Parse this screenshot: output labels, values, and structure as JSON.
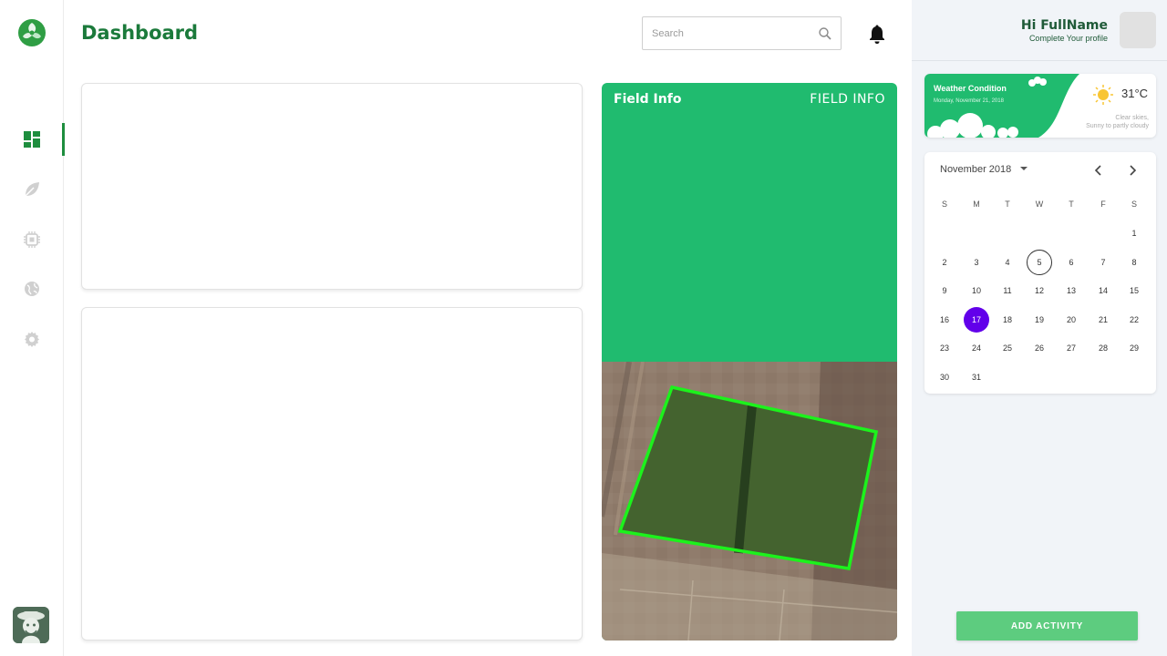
{
  "header": {
    "title": "Dashboard",
    "search_placeholder": "Search"
  },
  "nav": {
    "items": [
      {
        "icon": "dashboard-icon",
        "active": true
      },
      {
        "icon": "leaf-icon",
        "active": false
      },
      {
        "icon": "chip-icon",
        "active": false
      },
      {
        "icon": "globe-icon",
        "active": false
      },
      {
        "icon": "gear-icon",
        "active": false
      }
    ],
    "accent": "#1e8e3e"
  },
  "field_card": {
    "title": "Field Info",
    "tag": "FIELD INFO",
    "color": "#20bb6f"
  },
  "user": {
    "greeting": "Hi FullName",
    "subtitle": "Complete Your profile"
  },
  "weather": {
    "title": "Weather Condition",
    "date": "Monday, November 21, 2018",
    "temperature": "31°C",
    "description_line1": "Clear skies,",
    "description_line2": "Sunny to partly cloudy",
    "icon": "sun-icon"
  },
  "calendar": {
    "month_label": "November 2018",
    "weekdays": [
      "S",
      "M",
      "T",
      "W",
      "T",
      "F",
      "S"
    ],
    "first_weekday_index": 6,
    "days_in_month": 31,
    "today": 5,
    "selected": 17,
    "selected_color": "#6200ea"
  },
  "actions": {
    "add_activity": "ADD ACTIVITY",
    "button_color": "#5dcc7f"
  }
}
